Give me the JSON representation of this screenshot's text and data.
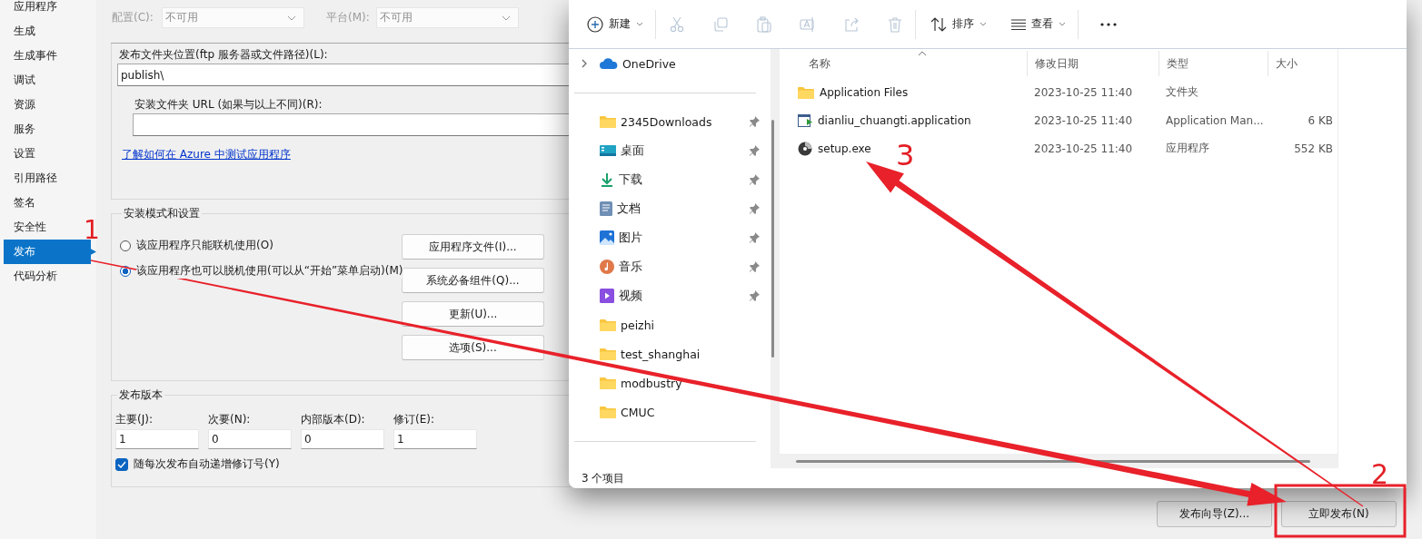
{
  "sidebar": {
    "items": [
      {
        "label": "应用程序",
        "selected": false
      },
      {
        "label": "生成",
        "selected": false
      },
      {
        "label": "生成事件",
        "selected": false
      },
      {
        "label": "调试",
        "selected": false
      },
      {
        "label": "资源",
        "selected": false
      },
      {
        "label": "服务",
        "selected": false
      },
      {
        "label": "设置",
        "selected": false
      },
      {
        "label": "引用路径",
        "selected": false
      },
      {
        "label": "签名",
        "selected": false
      },
      {
        "label": "安全性",
        "selected": false
      },
      {
        "label": "发布",
        "selected": true
      },
      {
        "label": "代码分析",
        "selected": false
      }
    ]
  },
  "config_row": {
    "fields": [
      {
        "label": "配置(C):",
        "value": "不可用",
        "disabled": true
      },
      {
        "label": "平台(M):",
        "value": "不可用",
        "disabled": true
      }
    ]
  },
  "publish_location": {
    "label": "发布文件夹位置(ftp 服务器或文件路径)(L):",
    "value": "publish\\",
    "install_url_label": "安装文件夹 URL (如果与以上不同)(R):",
    "link": "了解如何在 Azure 中测试应用程序"
  },
  "install_mode": {
    "title": "安装模式和设置",
    "options": [
      {
        "label": "该应用程序只能联机使用(O)",
        "selected": false
      },
      {
        "label": "该应用程序也可以脱机使用(可以从“开始”菜单启动)(M)",
        "selected": true
      }
    ],
    "buttons": [
      "应用程序文件(I)...",
      "系统必备组件(Q)...",
      "更新(U)...",
      "选项(S)..."
    ]
  },
  "publish_version": {
    "title": "发布版本",
    "fields": [
      {
        "label": "主要(J):",
        "value": "1"
      },
      {
        "label": "次要(N):",
        "value": "0"
      },
      {
        "label": "内部版本(D):",
        "value": "0"
      },
      {
        "label": "修订(E):",
        "value": "1"
      }
    ],
    "auto_increment": {
      "label": "随每次发布自动递增修订号(Y)",
      "checked": true
    }
  },
  "footer_buttons": [
    "发布向导(Z)...",
    "立即发布(N)"
  ],
  "explorer": {
    "toolbar": {
      "new_label": "新建",
      "sort_label": "排序",
      "view_label": "查看",
      "actions": [
        {
          "kind": "cut",
          "disabled": true
        },
        {
          "kind": "copy",
          "disabled": true
        },
        {
          "kind": "paste",
          "disabled": true
        },
        {
          "kind": "rename",
          "disabled": true
        },
        {
          "kind": "share",
          "disabled": true
        },
        {
          "kind": "delete",
          "disabled": true
        }
      ]
    },
    "nav_groups": [
      [
        {
          "label": "OneDrive",
          "kind": "cloud",
          "expandable": true,
          "pinned": false
        }
      ],
      [
        {
          "label": "2345Downloads",
          "kind": "folder",
          "expandable": false,
          "pinned": true
        },
        {
          "label": "桌面",
          "kind": "desktop",
          "expandable": false,
          "pinned": true
        },
        {
          "label": "下载",
          "kind": "download",
          "expandable": false,
          "pinned": true
        },
        {
          "label": "文档",
          "kind": "document",
          "expandable": false,
          "pinned": true
        },
        {
          "label": "图片",
          "kind": "picture",
          "expandable": false,
          "pinned": true
        },
        {
          "label": "音乐",
          "kind": "music",
          "expandable": false,
          "pinned": true
        },
        {
          "label": "视频",
          "kind": "video",
          "expandable": false,
          "pinned": true
        },
        {
          "label": "peizhi",
          "kind": "folder",
          "expandable": false,
          "pinned": false
        },
        {
          "label": "test_shanghai",
          "kind": "folder",
          "expandable": false,
          "pinned": false
        },
        {
          "label": "modbustry",
          "kind": "folder",
          "expandable": false,
          "pinned": false
        },
        {
          "label": "CMUC",
          "kind": "folder",
          "expandable": false,
          "pinned": false
        }
      ]
    ],
    "columns": [
      {
        "label": "名称",
        "sorted": true
      },
      {
        "label": "修改日期",
        "sorted": false
      },
      {
        "label": "类型",
        "sorted": false
      },
      {
        "label": "大小",
        "sorted": false
      }
    ],
    "files": [
      {
        "name": "Application Files",
        "kind": "folder",
        "modified": "2023-10-25 11:40",
        "type": "文件夹"
      },
      {
        "name": "dianliu_chuangti.application",
        "kind": "manifest",
        "modified": "2023-10-25 11:40",
        "type": "Application Man...",
        "size": "6 KB"
      },
      {
        "name": "setup.exe",
        "kind": "exe",
        "modified": "2023-10-25 11:40",
        "type": "应用程序",
        "size": "552 KB"
      }
    ],
    "status": "3 个项目"
  },
  "annotations": {
    "markers": [
      "1",
      "2",
      "3"
    ]
  }
}
